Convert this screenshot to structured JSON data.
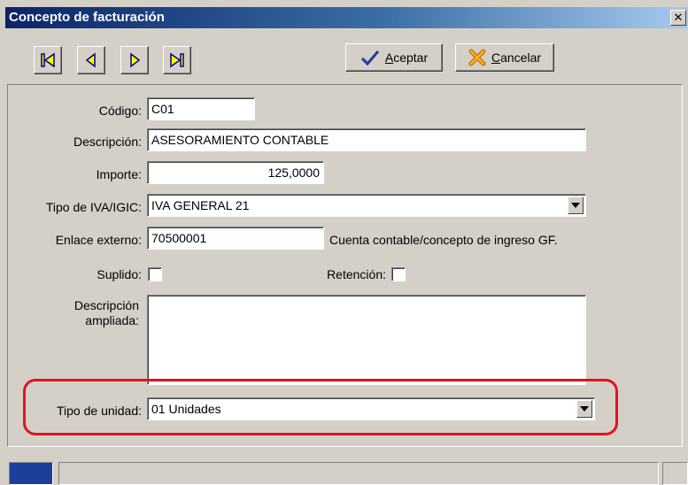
{
  "window": {
    "title": "Concepto de facturación"
  },
  "toolbar": {
    "accept_label": "Aceptar",
    "cancel_label": "Cancelar"
  },
  "form": {
    "codigo": {
      "label": "Código:",
      "value": "C01"
    },
    "descripcion": {
      "label": "Descripción:",
      "value": "ASESORAMIENTO CONTABLE"
    },
    "importe": {
      "label": "Importe:",
      "value": "125,0000"
    },
    "tipo_iva": {
      "label": "Tipo de IVA/IGIC:",
      "value": "IVA GENERAL 21"
    },
    "enlace": {
      "label": "Enlace externo:",
      "value": "70500001",
      "hint": "Cuenta contable/concepto de ingreso GF."
    },
    "suplido": {
      "label": "Suplido:"
    },
    "retencion": {
      "label": "Retención:"
    },
    "descripcion_ampliada": {
      "label_line1": "Descripción",
      "label_line2": "ampliada:",
      "value": ""
    },
    "tipo_unidad": {
      "label": "Tipo de unidad:",
      "value": "01 Unidades"
    }
  },
  "colors": {
    "highlight": "#e0141e",
    "titlebar": "#0a246a",
    "nav_icon": "#000080",
    "nav_fill": "#ffff00"
  }
}
